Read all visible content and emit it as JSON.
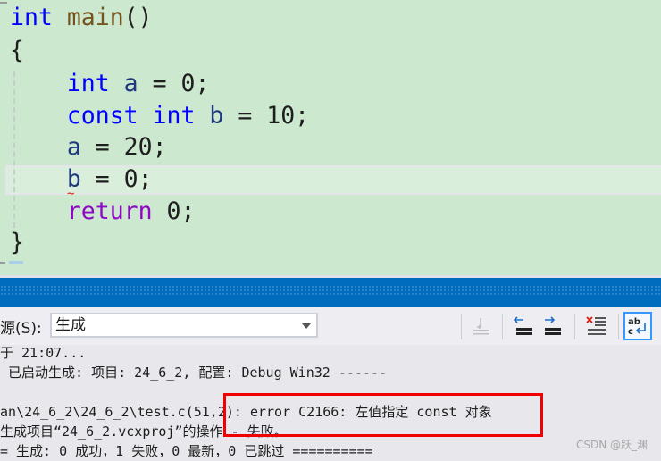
{
  "editor": {
    "lines": [
      [
        {
          "t": "int",
          "c": "kw"
        },
        {
          "t": " "
        },
        {
          "t": "main",
          "c": "fn"
        },
        {
          "t": "()"
        }
      ],
      [
        {
          "t": "{"
        }
      ],
      [
        {
          "t": "    "
        },
        {
          "t": "int",
          "c": "kw"
        },
        {
          "t": " "
        },
        {
          "t": "a",
          "c": "var"
        },
        {
          "t": " = 0;"
        }
      ],
      [
        {
          "t": "    "
        },
        {
          "t": "const",
          "c": "kw"
        },
        {
          "t": " "
        },
        {
          "t": "int",
          "c": "kw"
        },
        {
          "t": " "
        },
        {
          "t": "b",
          "c": "var"
        },
        {
          "t": " = 10;"
        }
      ],
      [
        {
          "t": "    "
        },
        {
          "t": "a",
          "c": "var"
        },
        {
          "t": " = 20;"
        }
      ],
      [
        {
          "t": "    "
        },
        {
          "t": "b",
          "c": "var"
        },
        {
          "t": " = 0;"
        }
      ],
      [
        {
          "t": "    "
        },
        {
          "t": "return",
          "c": "ret"
        },
        {
          "t": " 0;"
        }
      ],
      [
        {
          "t": "}"
        }
      ]
    ],
    "error_squiggle": "~"
  },
  "output": {
    "source_label": "源(S):",
    "source_value": "生成",
    "toolbar_icons": [
      "go-to-line-icon",
      "previous-message-icon",
      "next-message-icon",
      "clear-all-icon",
      "word-wrap-icon"
    ],
    "lines": [
      "于 21:07...",
      " 已启动生成: 项目: 24_6_2, 配置: Debug Win32 ------",
      "",
      "an\\24_6_2\\24_6_2\\test.c(51,2): error C2166: 左值指定 const 对象",
      "生成项目“24_6_2.vcxproj”的操作 - 失败。",
      "= 生成: 0 成功，1 失败，0 最新，0 已跳过 =========="
    ]
  },
  "watermark": "CSDN @跃_渊",
  "colors": {
    "editor_bg": "#cce8cf",
    "keyword": "#0000ff",
    "panel_title": "#006cbe",
    "highlight_box": "#f00000"
  }
}
